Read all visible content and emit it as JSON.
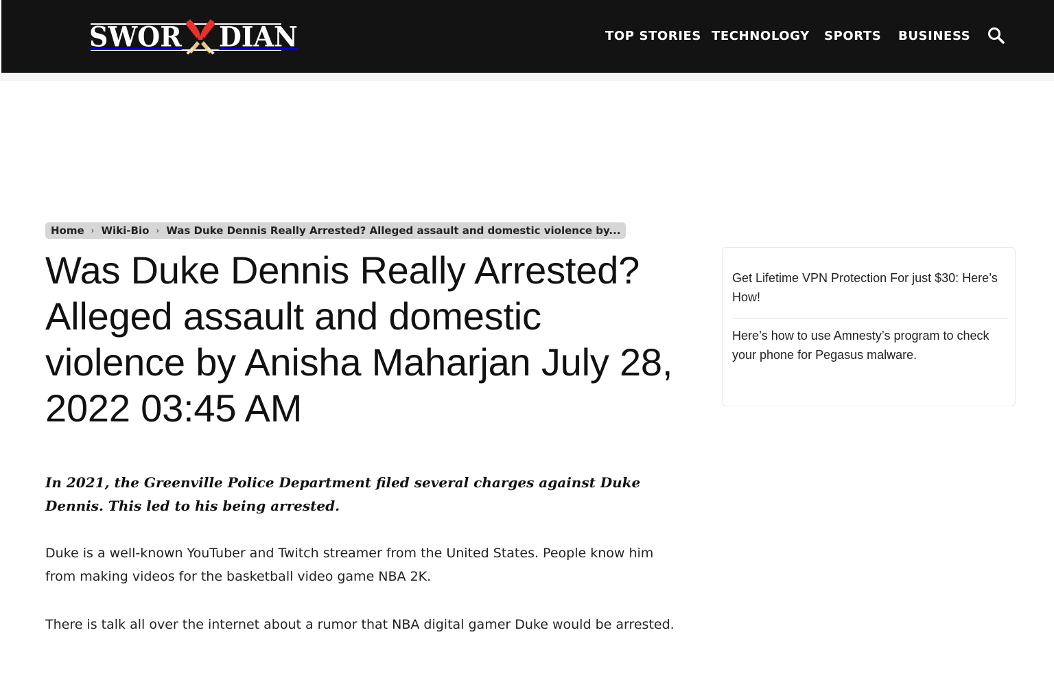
{
  "site": {
    "logo_text_left": "SWOR",
    "logo_text_right": "DIAN",
    "logo_colors": {
      "mark": "#e8322a",
      "hilt": "#e8c48a"
    }
  },
  "nav": {
    "items": [
      {
        "label": "TOP STORIES"
      },
      {
        "label": "TECHNOLOGY"
      },
      {
        "label": "SPORTS"
      },
      {
        "label": "BUSINESS"
      }
    ],
    "search_icon": "search-icon"
  },
  "breadcrumb": {
    "home": "Home",
    "category": "Wiki-Bio",
    "current": "Was Duke Dennis Really Arrested? Alleged assault and domestic violence by...",
    "separator": "›"
  },
  "article": {
    "title": "Was Duke Dennis Really Arrested? Alleged assault and domestic violence by Anisha Maharjan July 28, 2022 03:45 AM",
    "lead": "In 2021, the Greenville Police Department filed several charges against Duke Dennis. This led to his being arrested.",
    "paragraphs": [
      "Duke is a well-known YouTuber and Twitch streamer from the United States. People know him from making videos for the basketball video game NBA 2K.",
      "There is talk all over the internet about a rumor that NBA digital gamer Duke would be arrested."
    ]
  },
  "sidebar": {
    "links": [
      "Get Lifetime VPN Protection For just $30: Here’s How!",
      "Here’s how to use Amnesty’s program to check your phone for Pegasus malware."
    ]
  },
  "colors": {
    "header_bg": "#131313",
    "breadcrumb_bg": "#d6d6d6",
    "text": "#111111"
  }
}
